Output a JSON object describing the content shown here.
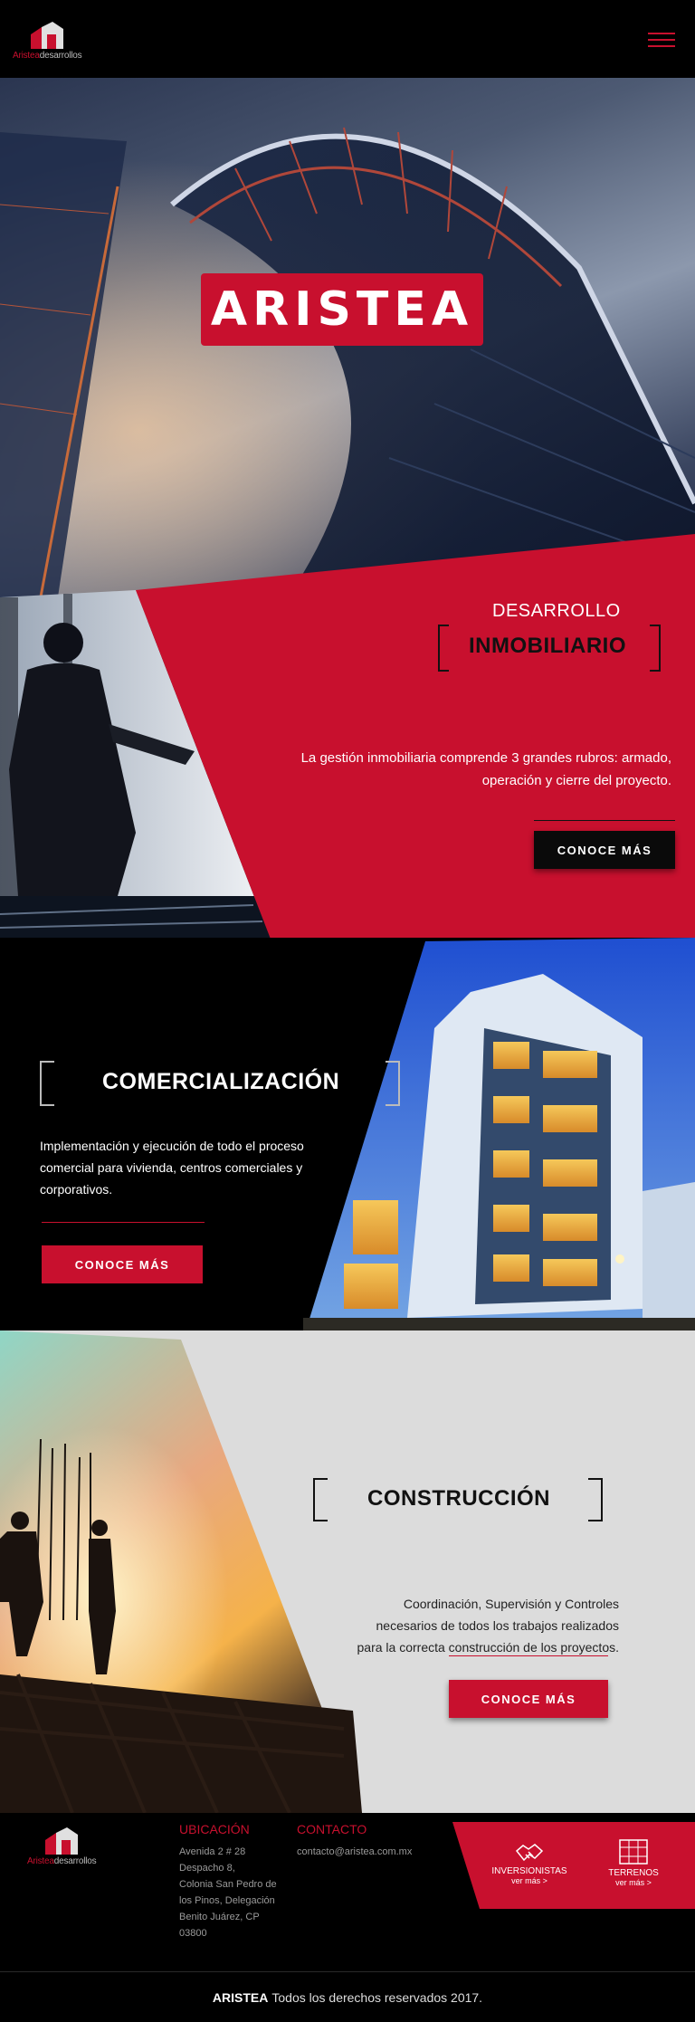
{
  "header": {
    "logo": {
      "brand": "Aristea",
      "suffix": "desarrollos"
    },
    "menu_icon": "hamburger-icon"
  },
  "hero": {
    "badge": "ARISTEA"
  },
  "inmobiliario": {
    "title_top": "DESARROLLO",
    "title": "INMOBILIARIO",
    "text_lines": [
      "La gestión inmobiliaria comprende 3 grandes rubros: armado,",
      "operación y cierre del proyecto."
    ],
    "button": "CONOCE MÁS"
  },
  "comercializacion": {
    "title": "COMERCIALIZACIÓN",
    "text_lines": [
      "Implementación y ejecución de todo el proceso",
      "comercial para vivienda, centros comerciales y",
      "corporativos."
    ],
    "button": "CONOCE MÁS"
  },
  "construccion": {
    "title": "CONSTRUCCIÓN",
    "text_lines": [
      "Coordinación, Supervisión y Controles",
      "necesarios de todos los trabajos realizados",
      "para la correcta construcción de los proyectos."
    ],
    "button": "CONOCE MÁS"
  },
  "footer": {
    "ubicacion": {
      "title": "UBICACIÓN",
      "lines": [
        "Avenida 2 # 28",
        "Despacho 8,",
        "Colonia San Pedro de",
        "los Pinos, Delegación",
        "Benito Juárez, CP",
        "03800"
      ]
    },
    "contacto": {
      "title": "CONTACTO",
      "email": "contacto@aristea.com.mx"
    },
    "links": [
      {
        "label": "INVERSIONISTAS",
        "sub": "ver más >",
        "icon": "handshake-icon"
      },
      {
        "label": "TERRENOS",
        "sub": "ver más >",
        "icon": "land-plot-icon"
      }
    ],
    "copyright_brand": "ARISTEA",
    "copyright_text": "Todos los derechos reservados 2017."
  },
  "colors": {
    "accent": "#c8102e",
    "dark": "#000000",
    "light_panel": "#dcdcdc"
  }
}
